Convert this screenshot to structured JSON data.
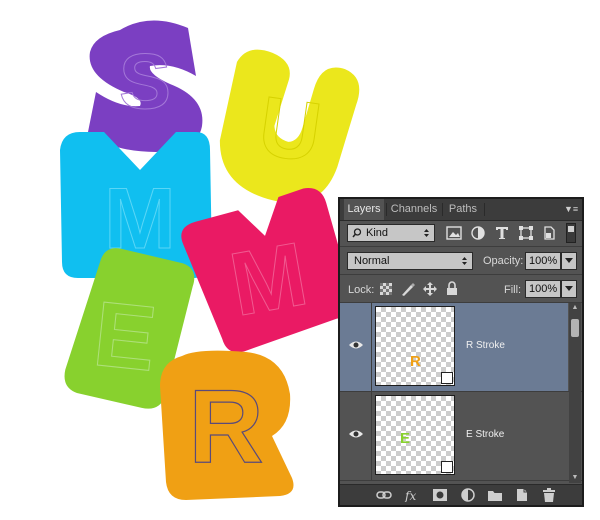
{
  "canvas": {
    "letters": [
      {
        "char": "S",
        "color": "#7b3fc2"
      },
      {
        "char": "U",
        "color": "#ebe71c"
      },
      {
        "char": "M",
        "color": "#10bff0"
      },
      {
        "char": "M",
        "color": "#ea1a64"
      },
      {
        "char": "E",
        "color": "#88d12e"
      },
      {
        "char": "R",
        "color": "#f0a014"
      }
    ]
  },
  "panel": {
    "tabs": [
      "Layers",
      "Channels",
      "Paths"
    ],
    "active_tab": "Layers",
    "filter_kind": "Kind",
    "blend_mode": "Normal",
    "opacity_label": "Opacity:",
    "opacity_value": "100%",
    "lock_label": "Lock:",
    "fill_label": "Fill:",
    "fill_value": "100%",
    "layers": [
      {
        "name": "R Stroke",
        "thumb_letter": "R",
        "thumb_color": "#f0a014",
        "selected": true,
        "visible": true
      },
      {
        "name": "E Stroke",
        "thumb_letter": "E",
        "thumb_color": "#88d12e",
        "selected": false,
        "visible": true
      }
    ],
    "bottom_icons": [
      "link-icon",
      "fx-icon",
      "mask-icon",
      "adjustment-icon",
      "folder-icon",
      "new-layer-icon",
      "trash-icon"
    ],
    "colors": {
      "panel_bg": "#535353",
      "selected_row": "#6b7b94",
      "tab_bar": "#3c3c3c"
    }
  }
}
